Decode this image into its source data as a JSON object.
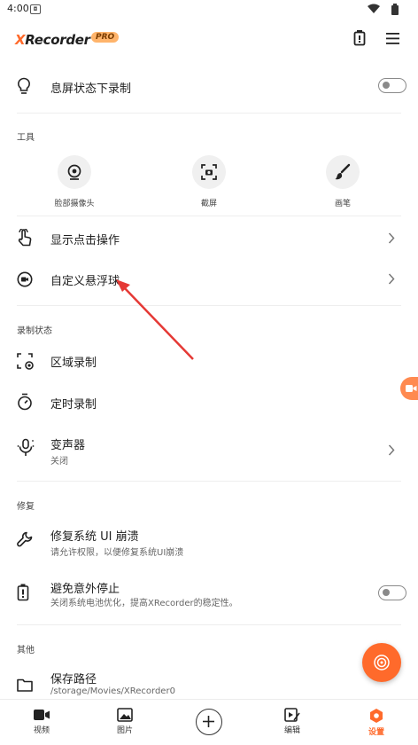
{
  "status_bar": {
    "time": "4:00"
  },
  "app": {
    "name_prefix": "X",
    "name_rest": "Recorder",
    "pro_badge": "PRO"
  },
  "settings": {
    "screen_off": {
      "title": "息屏状态下录制",
      "toggle_on": false
    },
    "tools_section": "工具",
    "tools": [
      {
        "label": "脸部摄像头",
        "icon": "face-camera-icon"
      },
      {
        "label": "截屏",
        "icon": "screenshot-icon"
      },
      {
        "label": "画笔",
        "icon": "brush-icon"
      }
    ],
    "show_touches": {
      "title": "显示点击操作"
    },
    "floating_ball": {
      "title": "自定义悬浮球"
    },
    "record_state_section": "录制状态",
    "region_record": {
      "title": "区域录制"
    },
    "timed_record": {
      "title": "定时录制"
    },
    "voice_changer": {
      "title": "变声器",
      "subtitle": "关闭"
    },
    "repair_section": "修复",
    "repair_ui": {
      "title": "修复系统 UI 崩溃",
      "subtitle": "请允许权限，以便修复系统UI崩溃"
    },
    "avoid_stop": {
      "title": "避免意外停止",
      "subtitle": "关闭系统电池优化，提高XRecorder的稳定性。",
      "toggle_on": false
    },
    "other_section": "其他",
    "save_path": {
      "title": "保存路径",
      "subtitle": "/storage/Movies/XRecorder0"
    }
  },
  "bottom_nav": [
    {
      "label": "视频",
      "icon": "video-icon"
    },
    {
      "label": "图片",
      "icon": "image-icon"
    },
    {
      "label": "",
      "icon": "add-icon"
    },
    {
      "label": "编辑",
      "icon": "edit-icon"
    },
    {
      "label": "设置",
      "icon": "settings-icon",
      "active": true
    }
  ],
  "colors": {
    "accent": "#ff6a2b",
    "pro_badge": "#ffb46b",
    "annotation_arrow": "#e53935"
  }
}
